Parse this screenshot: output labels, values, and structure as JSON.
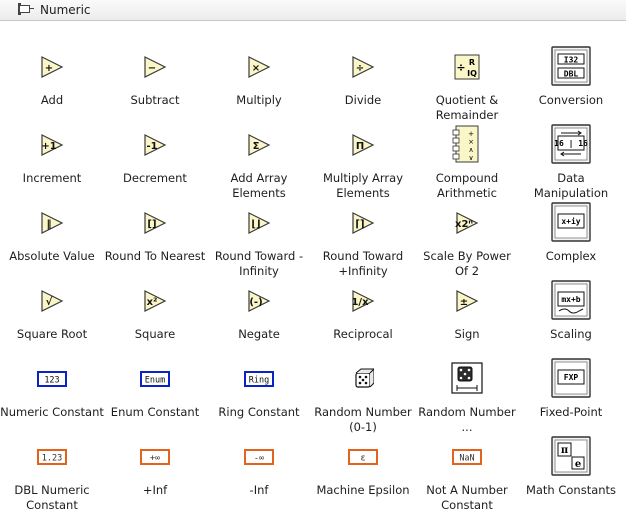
{
  "palette": {
    "title": "Numeric"
  },
  "colors": {
    "prim_fill": "#fbf6c8",
    "prim_stroke": "#3a3a3a",
    "const_blue": "#0a22c8",
    "const_orange": "#e2631c",
    "sub_bg": "#f3f3f3"
  },
  "items": [
    {
      "label": "Add",
      "icon": "add-icon"
    },
    {
      "label": "Subtract",
      "icon": "subtract-icon"
    },
    {
      "label": "Multiply",
      "icon": "multiply-icon"
    },
    {
      "label": "Divide",
      "icon": "divide-icon"
    },
    {
      "label": "Quotient & Remainder",
      "icon": "quotient-remainder-icon",
      "glyph": "R\nIQ"
    },
    {
      "label": "Conversion",
      "icon": "conversion-icon",
      "glyph": "I32\nDBL"
    },
    {
      "label": "Increment",
      "icon": "increment-icon"
    },
    {
      "label": "Decrement",
      "icon": "decrement-icon"
    },
    {
      "label": "Add Array Elements",
      "icon": "add-array-elements-icon"
    },
    {
      "label": "Multiply Array Elements",
      "icon": "multiply-array-elements-icon"
    },
    {
      "label": "Compound Arithmetic",
      "icon": "compound-arithmetic-icon"
    },
    {
      "label": "Data Manipulation",
      "icon": "data-manipulation-icon",
      "glyph": "16 | 16"
    },
    {
      "label": "Absolute Value",
      "icon": "absolute-value-icon"
    },
    {
      "label": "Round To Nearest",
      "icon": "round-to-nearest-icon"
    },
    {
      "label": "Round Toward -Infinity",
      "icon": "round-toward-neg-infinity-icon"
    },
    {
      "label": "Round Toward +Infinity",
      "icon": "round-toward-pos-infinity-icon"
    },
    {
      "label": "Scale By Power Of 2",
      "icon": "scale-by-power-of-2-icon"
    },
    {
      "label": "Complex",
      "icon": "complex-icon",
      "glyph": "x+iy"
    },
    {
      "label": "Square Root",
      "icon": "square-root-icon"
    },
    {
      "label": "Square",
      "icon": "square-icon"
    },
    {
      "label": "Negate",
      "icon": "negate-icon"
    },
    {
      "label": "Reciprocal",
      "icon": "reciprocal-icon"
    },
    {
      "label": "Sign",
      "icon": "sign-icon"
    },
    {
      "label": "Scaling",
      "icon": "scaling-icon",
      "glyph": "mx+b"
    },
    {
      "label": "Numeric Constant",
      "icon": "numeric-constant-icon",
      "glyph": "123"
    },
    {
      "label": "Enum Constant",
      "icon": "enum-constant-icon",
      "glyph": "Enum"
    },
    {
      "label": "Ring Constant",
      "icon": "ring-constant-icon",
      "glyph": "Ring"
    },
    {
      "label": "Random Number (0-1)",
      "icon": "random-number-icon"
    },
    {
      "label": "Random Number ...",
      "icon": "random-number-range-icon"
    },
    {
      "label": "Fixed-Point",
      "icon": "fixed-point-icon",
      "glyph": "FXP"
    },
    {
      "label": "DBL Numeric Constant",
      "icon": "dbl-numeric-constant-icon",
      "glyph": "1.23"
    },
    {
      "label": "+Inf",
      "icon": "pos-inf-constant-icon",
      "glyph": "+∞"
    },
    {
      "label": "-Inf",
      "icon": "neg-inf-constant-icon",
      "glyph": "-∞"
    },
    {
      "label": "Machine Epsilon",
      "icon": "machine-epsilon-icon",
      "glyph": "ε"
    },
    {
      "label": "Not A Number Constant",
      "icon": "nan-constant-icon",
      "glyph": "NaN"
    },
    {
      "label": "Math Constants",
      "icon": "math-constants-icon",
      "glyph": "π e"
    }
  ]
}
